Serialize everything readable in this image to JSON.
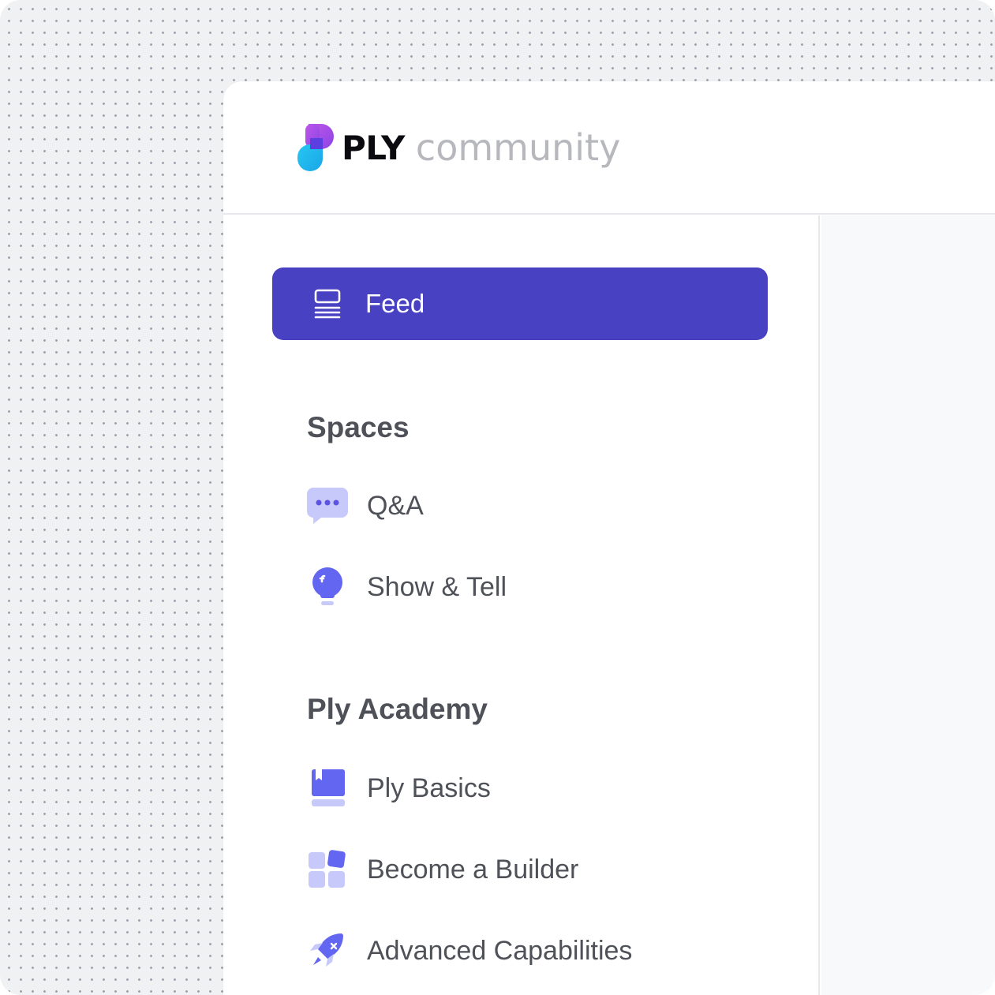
{
  "header": {
    "brand": "PLY",
    "brand_sub": "community"
  },
  "colors": {
    "accent": "#4841c1",
    "icon_purple": "#6366f1",
    "icon_light": "#c7c9fb",
    "text": "#4f5158",
    "muted": "#b7b8bd"
  },
  "sidebar": {
    "feed": {
      "label": "Feed",
      "icon": "feed-icon"
    },
    "sections": [
      {
        "title": "Spaces",
        "items": [
          {
            "label": "Q&A",
            "icon": "chat-bubble-icon"
          },
          {
            "label": "Show & Tell",
            "icon": "lightbulb-icon"
          }
        ]
      },
      {
        "title": "Ply Academy",
        "items": [
          {
            "label": "Ply Basics",
            "icon": "book-icon"
          },
          {
            "label": "Become a Builder",
            "icon": "blocks-icon"
          },
          {
            "label": "Advanced Capabilities",
            "icon": "rocket-icon"
          }
        ]
      }
    ]
  }
}
